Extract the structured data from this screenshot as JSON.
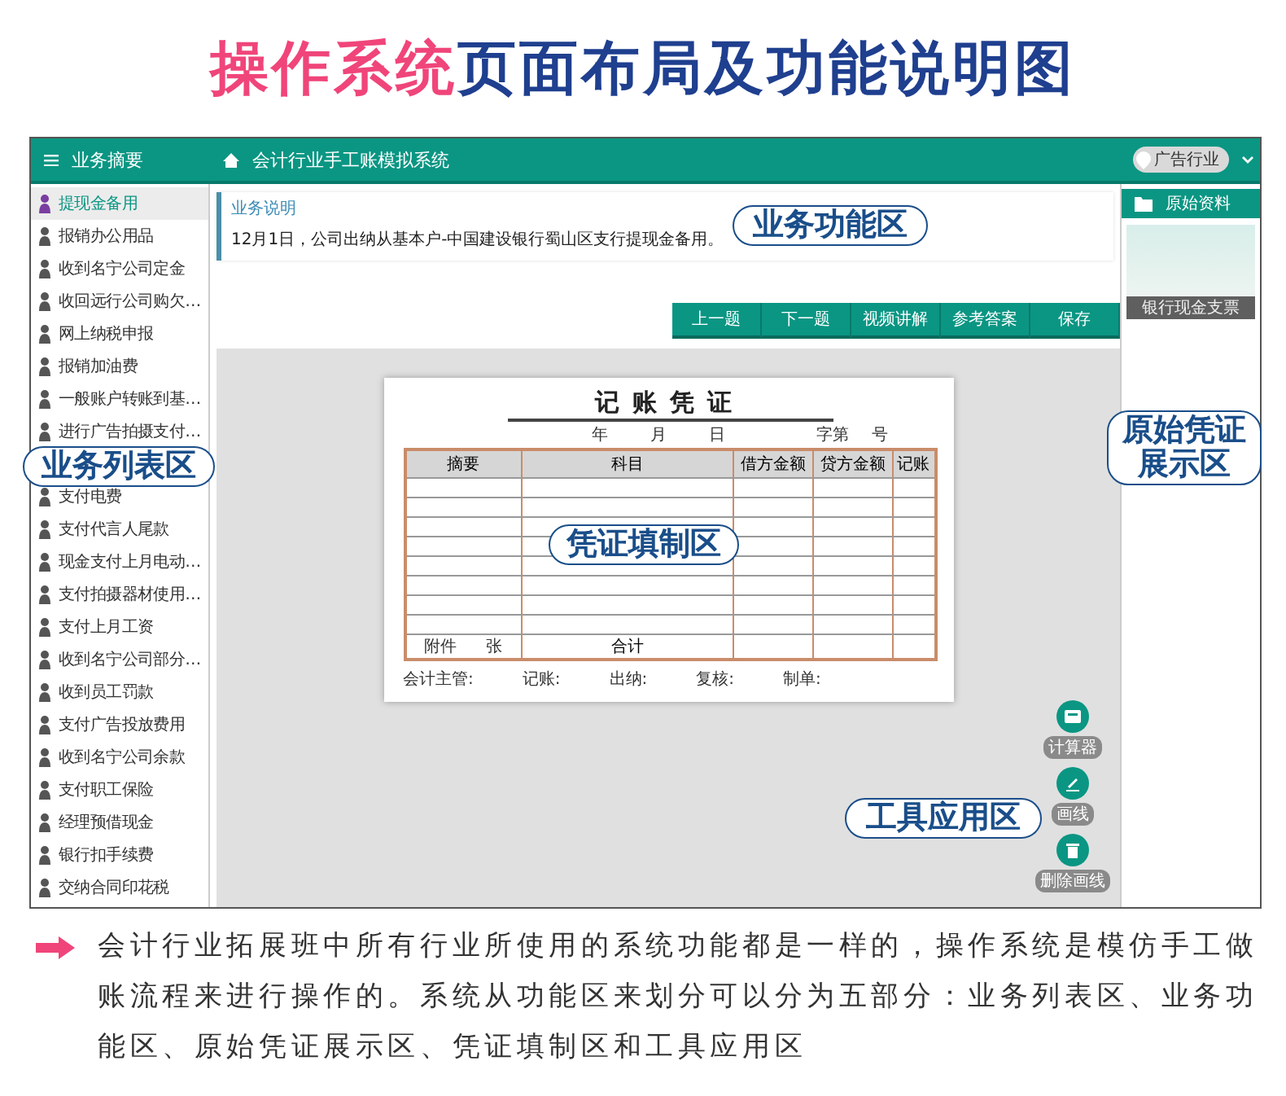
{
  "page_title": {
    "highlight": "操作系统",
    "rest": "页面布局及功能说明图"
  },
  "app": {
    "sidebar_title": "业务摘要",
    "title": "会计行业手工账模拟系统",
    "industry": "广告行业"
  },
  "sidebar": {
    "items": [
      {
        "label": "提现金备用",
        "selected": true
      },
      {
        "label": "报销办公用品",
        "selected": false
      },
      {
        "label": "收到名宁公司定金",
        "selected": false
      },
      {
        "label": "收回远行公司购欠…",
        "selected": false
      },
      {
        "label": "网上纳税申报",
        "selected": false
      },
      {
        "label": "报销加油费",
        "selected": false
      },
      {
        "label": "一般账户转账到基…",
        "selected": false
      },
      {
        "label": "进行广告拍摄支付…",
        "selected": false
      },
      {
        "label": "支付电费",
        "selected": false
      },
      {
        "label": "支付代言人尾款",
        "selected": false
      },
      {
        "label": "现金支付上月电动…",
        "selected": false
      },
      {
        "label": "支付拍摄器材使用…",
        "selected": false
      },
      {
        "label": "支付上月工资",
        "selected": false
      },
      {
        "label": "收到名宁公司部分…",
        "selected": false
      },
      {
        "label": "收到员工罚款",
        "selected": false
      },
      {
        "label": "支付广告投放费用",
        "selected": false
      },
      {
        "label": "收到名宁公司余款",
        "selected": false
      },
      {
        "label": "支付职工保险",
        "selected": false
      },
      {
        "label": "经理预借现金",
        "selected": false
      },
      {
        "label": "银行扣手续费",
        "selected": false
      },
      {
        "label": "交纳合同印花税",
        "selected": false
      }
    ]
  },
  "business": {
    "heading": "业务说明",
    "text": "12月1日，公司出纳从基本户-中国建设银行蜀山区支行提现金备用。"
  },
  "actions": [
    "上一题",
    "下一题",
    "视频讲解",
    "参考答案",
    "保存"
  ],
  "voucher": {
    "title": "记账凭证",
    "date_parts": [
      "年",
      "月",
      "日"
    ],
    "number_parts": [
      "字第",
      "号"
    ],
    "columns": [
      "摘要",
      "科目",
      "借方金额",
      "贷方金额",
      "记账"
    ],
    "attachment": [
      "附件",
      "张"
    ],
    "total": "合计",
    "signatures": [
      "会计主管:",
      "记账:",
      "出纳:",
      "复核:",
      "制单:"
    ]
  },
  "original_docs": {
    "heading": "原始资料",
    "caption": "银行现金支票"
  },
  "tools": [
    {
      "kind": "calculator",
      "label": "计算器"
    },
    {
      "kind": "draw",
      "label": "画线"
    },
    {
      "kind": "delete",
      "label": "删除画线"
    }
  ],
  "annotations": [
    "业务功能区",
    "业务列表区",
    "原始凭证展示区",
    "凭证填制区",
    "工具应用区"
  ],
  "description": "会计行业拓展班中所有行业所使用的系统功能都是一样的，操作系统是模仿手工做账流程来进行操作的。系统从功能区来划分可以分为五部分：业务列表区、业务功能区、原始凭证展示区、凭证填制区和工具应用区"
}
